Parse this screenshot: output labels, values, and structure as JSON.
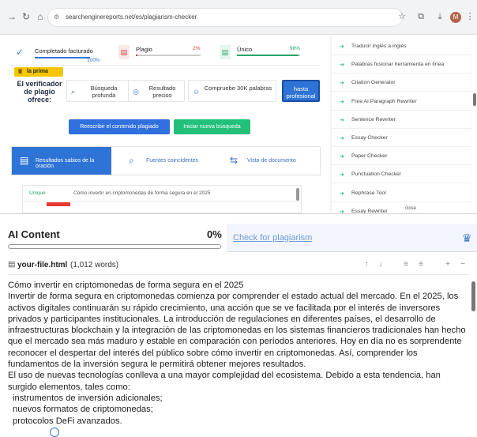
{
  "browser": {
    "url": "searchenginereports.net/es/plagiarism-checker",
    "profile_initial": "M"
  },
  "stats": [
    {
      "label": "Completado facturado",
      "pct": "100%",
      "color": "#2e73d6",
      "fill": 1.0
    },
    {
      "label": "Plagio",
      "pct": "2%",
      "color": "#e53935",
      "fill": 0.02
    },
    {
      "label": "Único",
      "pct": "98%",
      "color": "#2aa36b",
      "fill": 0.98
    }
  ],
  "verifier": {
    "badge": "la prima",
    "title": "El verificador de plagio ofrece:",
    "plans": [
      "Búsqueda profunda",
      "Resultado preciso",
      "Compruebe 30K palabras",
      "hasta profesional"
    ]
  },
  "actions": {
    "rewrite": "Reescribir el contenido plagiado",
    "new_search": "Iniciar nueva búsqueda"
  },
  "result_tabs": [
    "Resultados sabios de la oración",
    "Fuentes coincidentes",
    "Vista de documento"
  ],
  "results_table": {
    "row1_status": "Unique",
    "row1_title": "Cómo invertir en criptomonedas de forma segura en el 2025"
  },
  "tools": [
    "Traducir inglés a inglés",
    "Palabras fusionar herramienta en línea",
    "Citation Generator",
    "Free AI Paragraph Rewriter",
    "Sentence Rewriter",
    "Essay Checker",
    "Paper Checker",
    "Punctuation Checker",
    "Rephrase Tool",
    "Essay Rewriter"
  ],
  "close_tag": "close",
  "ai_panel": {
    "title": "AI Content",
    "pct": "0%",
    "fill": 0.0,
    "check_link": "Check for plagiarism",
    "file_name": "your-file.html",
    "word_count": "(1,012 words)"
  },
  "content": {
    "heading": "Cómo invertir en criptomonedas de forma segura en el 2025",
    "para1": "Invertir de forma segura en criptomonedas comienza por comprender el estado actual del mercado. En el 2025, los activos digitales continuarán su rápido crecimiento, una acción que se ve facilitada por el interés de inversores privados y participantes institucionales. La introducción de regulaciones en diferentes países, el desarrollo de infraestructuras blockchain y la integración de las criptomonedas en los sistemas financieros tradicionales han hecho que el mercado sea más maduro y estable en comparación con períodos anteriores. Hoy en día no es sorprendente reconocer el despertar del interés del público sobre cómo invertir en criptomonedas. Así, comprender los fundamentos de la inversión segura le permitirá obtener mejores resultados.",
    "para2": "El uso de nuevas tecnologías conlleva a una mayor complejidad del ecosistema. Debido a esta tendencia, han surgido elementos, tales como:",
    "list": [
      "instrumentos de inversión adicionales;",
      "nuevos formatos de criptomonedas;",
      "protocolos DeFi avanzados."
    ]
  }
}
